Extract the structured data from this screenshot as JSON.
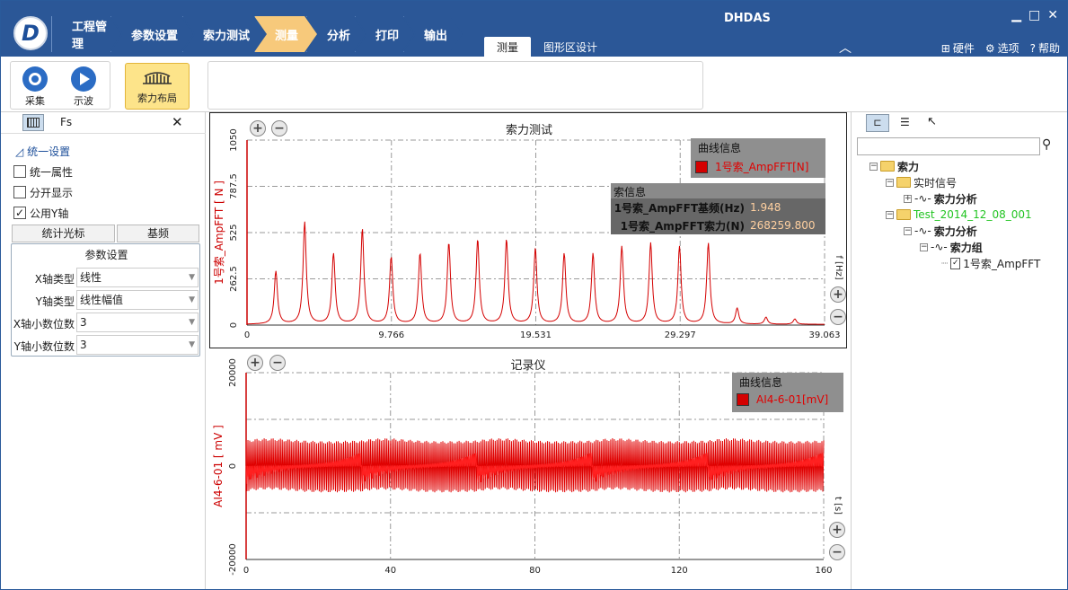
{
  "app": {
    "title": "DHDAS",
    "steps": [
      "工程管理",
      "参数设置",
      "索力测试",
      "测量",
      "分析",
      "打印",
      "输出"
    ],
    "active_step": "测量",
    "ribbon_tabs": [
      "测量",
      "图形区设计"
    ],
    "top_right": {
      "hardware": "硬件",
      "options": "选项",
      "help": "帮助"
    }
  },
  "ribbon": {
    "buttons": [
      {
        "label": "采集",
        "icon": "record-icon"
      },
      {
        "label": "示波",
        "icon": "play-icon"
      },
      {
        "label": "索力布局",
        "icon": "bridge-icon"
      }
    ]
  },
  "left_panel": {
    "toolbar_tab": "Fs",
    "section": "统一设置",
    "checkboxes": [
      {
        "label": "统一属性",
        "checked": false
      },
      {
        "label": "分开显示",
        "checked": false
      },
      {
        "label": "公用Y轴",
        "checked": true
      }
    ],
    "tabs": [
      "统计光标",
      "基频"
    ],
    "params_title": "参数设置",
    "params": [
      {
        "label": "X轴类型",
        "value": "线性"
      },
      {
        "label": "Y轴类型",
        "value": "线性幅值"
      },
      {
        "label": "X轴小数位数",
        "value": "3"
      },
      {
        "label": "Y轴小数位数",
        "value": "3"
      }
    ]
  },
  "chart1": {
    "title": "索力测试",
    "ylabel": "1号索_AmpFFT [ N ]",
    "xunit": "f [Hz]",
    "legend_title": "曲线信息",
    "legend_item": "1号索_AmpFFT[N]",
    "info_title": "索信息",
    "info_rows": [
      {
        "key": "1号索_AmpFFT基频(Hz)",
        "value": "1.948"
      },
      {
        "key": "1号索_AmpFFT索力(N)",
        "value": "268259.800"
      }
    ]
  },
  "chart2": {
    "title": "记录仪",
    "ylabel": "AI4-6-01 [ mV ]",
    "xunit": "t [s]",
    "legend_title": "曲线信息",
    "legend_item": "AI4-6-01[mV]"
  },
  "chart_data": [
    {
      "type": "line",
      "title": "索力测试",
      "xlabel": "f [Hz]",
      "ylabel": "1号索_AmpFFT [ N ]",
      "xlim": [
        0,
        39.063
      ],
      "ylim": [
        0,
        1050
      ],
      "xticks": [
        "0",
        "9.766",
        "19.531",
        "29.297",
        "39.063"
      ],
      "yticks": [
        "0",
        "262.5",
        "525",
        "787.5",
        "1050"
      ],
      "series": [
        {
          "name": "1号索_AmpFFT[N]",
          "peaks_x": [
            1.95,
            3.9,
            5.85,
            7.8,
            9.75,
            11.7,
            13.65,
            15.6,
            17.55,
            19.5,
            21.45,
            23.4,
            25.35,
            27.3,
            29.25,
            31.2,
            33.15,
            35.1,
            37.05
          ],
          "peaks_y": [
            300,
            580,
            400,
            540,
            380,
            400,
            460,
            480,
            480,
            430,
            400,
            400,
            440,
            460,
            440,
            460,
            90,
            40,
            30
          ]
        }
      ]
    },
    {
      "type": "line",
      "title": "记录仪",
      "xlabel": "t [s]",
      "ylabel": "AI4-6-01 [ mV ]",
      "xlim": [
        0,
        160
      ],
      "ylim": [
        -20000,
        20000
      ],
      "xticks": [
        "0",
        "40",
        "80",
        "120",
        "160"
      ],
      "yticks": [
        "-20000",
        "0",
        "20000"
      ],
      "series": [
        {
          "name": "AI4-6-01[mV]",
          "amplitude": 5500,
          "duration": 160
        }
      ]
    }
  ]
}
